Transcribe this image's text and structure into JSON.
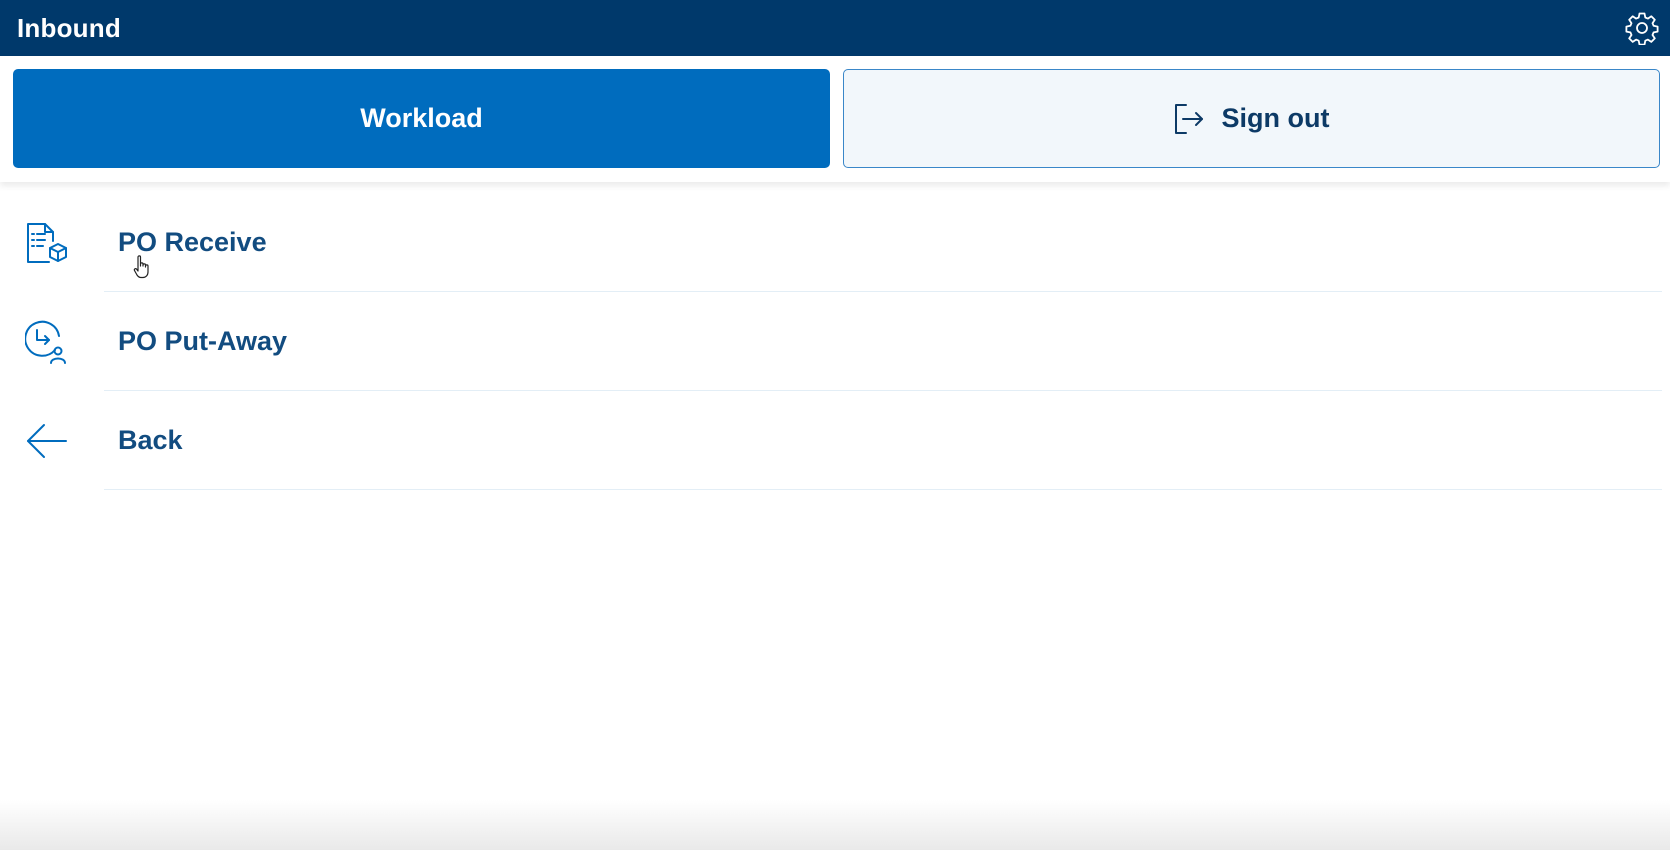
{
  "window": {
    "title": "Inbound"
  },
  "toolbar": {
    "workload_label": "Workload",
    "signout_label": "Sign out"
  },
  "menu": {
    "items": [
      {
        "label": "PO Receive",
        "icon": "document-box-icon"
      },
      {
        "label": "PO Put-Away",
        "icon": "putaway-person-icon"
      },
      {
        "label": "Back",
        "icon": "arrow-left-icon"
      }
    ]
  },
  "icons": {
    "settings": "gear-icon",
    "signout": "sign-out-icon",
    "cursor": "hand-pointer-icon"
  },
  "colors": {
    "titlebar": "#00396b",
    "accent": "#006cbe",
    "text": "#124c80",
    "signout_bg": "#f2f7fb"
  }
}
